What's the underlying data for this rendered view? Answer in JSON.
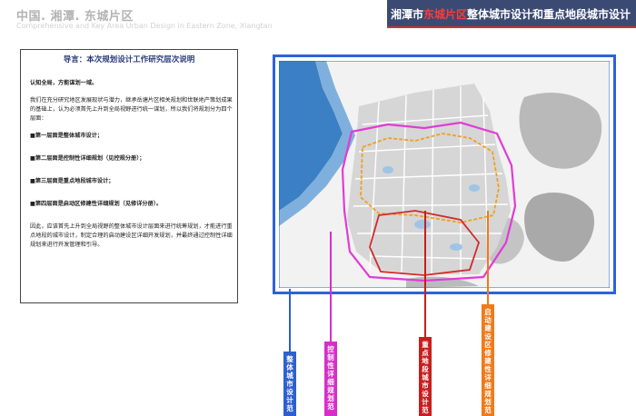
{
  "header": {
    "brand_cn": "中国. 湘潭. 东城片区",
    "brand_en": "Comprehensive and Key Area Urban Design  in Eastern Zone, Xiangtan",
    "title_prefix": "湘潭市",
    "title_highlight": "东城片区",
    "title_suffix": "整体城市设计和重点地段城市设计"
  },
  "doc": {
    "title": "导言：本次规划设计工作研究层次说明",
    "subtitle": "认知全局，方能谋划一域。",
    "intro": "我们在充分研究地区发展现状与潜力，继承岳塘片区相关规划和世联地产策划成果的基础上，认为必须首先上升到全局视野进行统一谋划，所以我们将规划分为四个层面：",
    "layers": [
      "■第一层面是整体城市设计；",
      "■第二层面是控制性详细规划（见控规分册）；",
      "■第三层面是重点地段城市设计；",
      "■第四层面是启动区修建性详细规划（见修详分册）。"
    ],
    "conclusion": "因此，应该首先上升到全局视野的整体城市设计层面来进行统筹规划，才能进行重点地段的城市设计，制定合理的启动建设区详细开发规划，并最终通过控制性详细规划来进行开发管理和引导。"
  },
  "legend_labels": [
    {
      "text": "整体城市设计范",
      "color": "#2d5fd0"
    },
    {
      "text": "控制性详细规划范",
      "color": "#d62fc9"
    },
    {
      "text": "重点地段城市设计范",
      "color": "#c81e1e"
    },
    {
      "text": "启动建设区修建性详细规划范",
      "color": "#f07a1a"
    }
  ],
  "colors": {
    "accent_blue": "#2d62d8",
    "title_bg": "#3b4a73",
    "title_highlight": "#ff3b3b"
  }
}
